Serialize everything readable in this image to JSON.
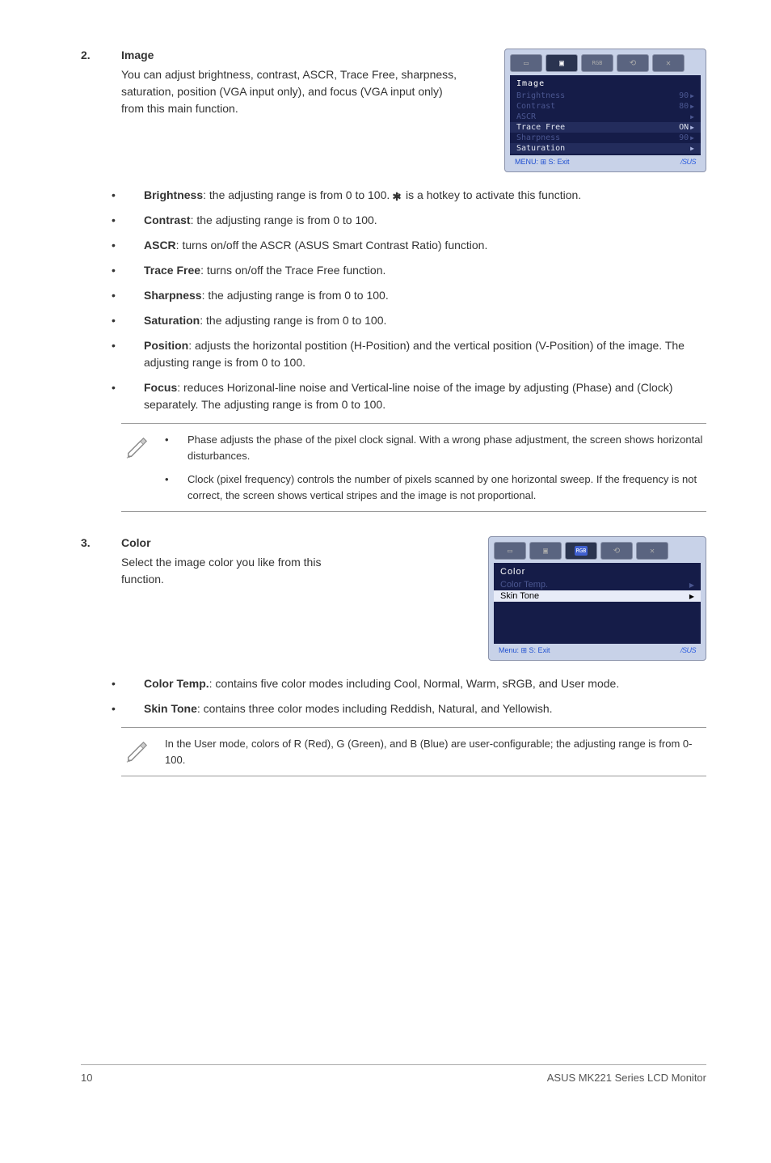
{
  "sec2": {
    "num": "2.",
    "title": "Image",
    "intro": "You can adjust brightness, contrast, ASCR, Trace Free, sharpness, saturation, position (VGA input only), and focus (VGA input only) from this main function.",
    "osd": {
      "title": "Image",
      "rows": [
        {
          "label": "Brightness",
          "value": "90",
          "muted": true
        },
        {
          "label": "Contrast",
          "value": "80",
          "muted": true
        },
        {
          "label": "ASCR",
          "value": "",
          "muted": true
        },
        {
          "label": "Trace Free",
          "value": "ON",
          "muted": false
        },
        {
          "label": "Sharpness",
          "value": "90",
          "muted": true
        },
        {
          "label": "Saturation",
          "value": "",
          "muted": false
        }
      ],
      "footer_left": "MENU: ⊞   S: Exit",
      "footer_brand": "/SUS"
    },
    "items": [
      {
        "term": "Brightness",
        "text_before": ": the adjusting range is from 0 to 100. ",
        "icon": true,
        "text_after": " is a hotkey to activate this function."
      },
      {
        "term": "Contrast",
        "text": ": the adjusting range is from 0 to 100."
      },
      {
        "term": "ASCR",
        "text": ": turns on/off the ASCR (ASUS Smart Contrast Ratio) function."
      },
      {
        "term": "Trace Free",
        "text": ": turns on/off the Trace Free function."
      },
      {
        "term": "Sharpness",
        "text": ": the adjusting range is from 0 to 100."
      },
      {
        "term": "Saturation",
        "text": ": the adjusting range is from 0 to 100."
      },
      {
        "term": "Position",
        "text": ": adjusts the horizontal postition (H-Position) and the vertical position (V-Position) of the image. The adjusting range is from 0 to 100."
      },
      {
        "term": "Focus",
        "text": ": reduces Horizonal-line noise and Vertical-line noise of the image by adjusting (Phase) and (Clock) separately. The adjusting range is from 0 to 100."
      }
    ],
    "notes": [
      "Phase adjusts the phase of the pixel clock signal. With a wrong phase adjustment, the screen shows  horizontal disturbances.",
      "Clock (pixel frequency) controls the number of pixels scanned by one horizontal sweep. If the frequency is not correct, the screen shows vertical stripes and the image is not proportional."
    ]
  },
  "sec3": {
    "num": "3.",
    "title": "Color",
    "intro": "Select the image color you like from this function.",
    "osd": {
      "title": "Color",
      "rows": [
        {
          "label": "Color Temp.",
          "value": "",
          "muted": true
        },
        {
          "label": "Skin Tone",
          "value": "",
          "muted": false
        }
      ],
      "footer_left": "Menu: ⊞    S: Exit",
      "footer_brand": "/SUS"
    },
    "items": [
      {
        "term": "Color Temp.",
        "text": ": contains five color modes including Cool, Normal, Warm, sRGB, and User mode."
      },
      {
        "term": "Skin Tone",
        "text": ": contains three color modes including Reddish, Natural, and Yellowish."
      }
    ],
    "note": "In the User mode, colors of R (Red), G (Green), and B (Blue) are user-configurable; the adjusting range is from 0-100."
  },
  "footer": {
    "page": "10",
    "product": "ASUS MK221 Series LCD Monitor"
  }
}
